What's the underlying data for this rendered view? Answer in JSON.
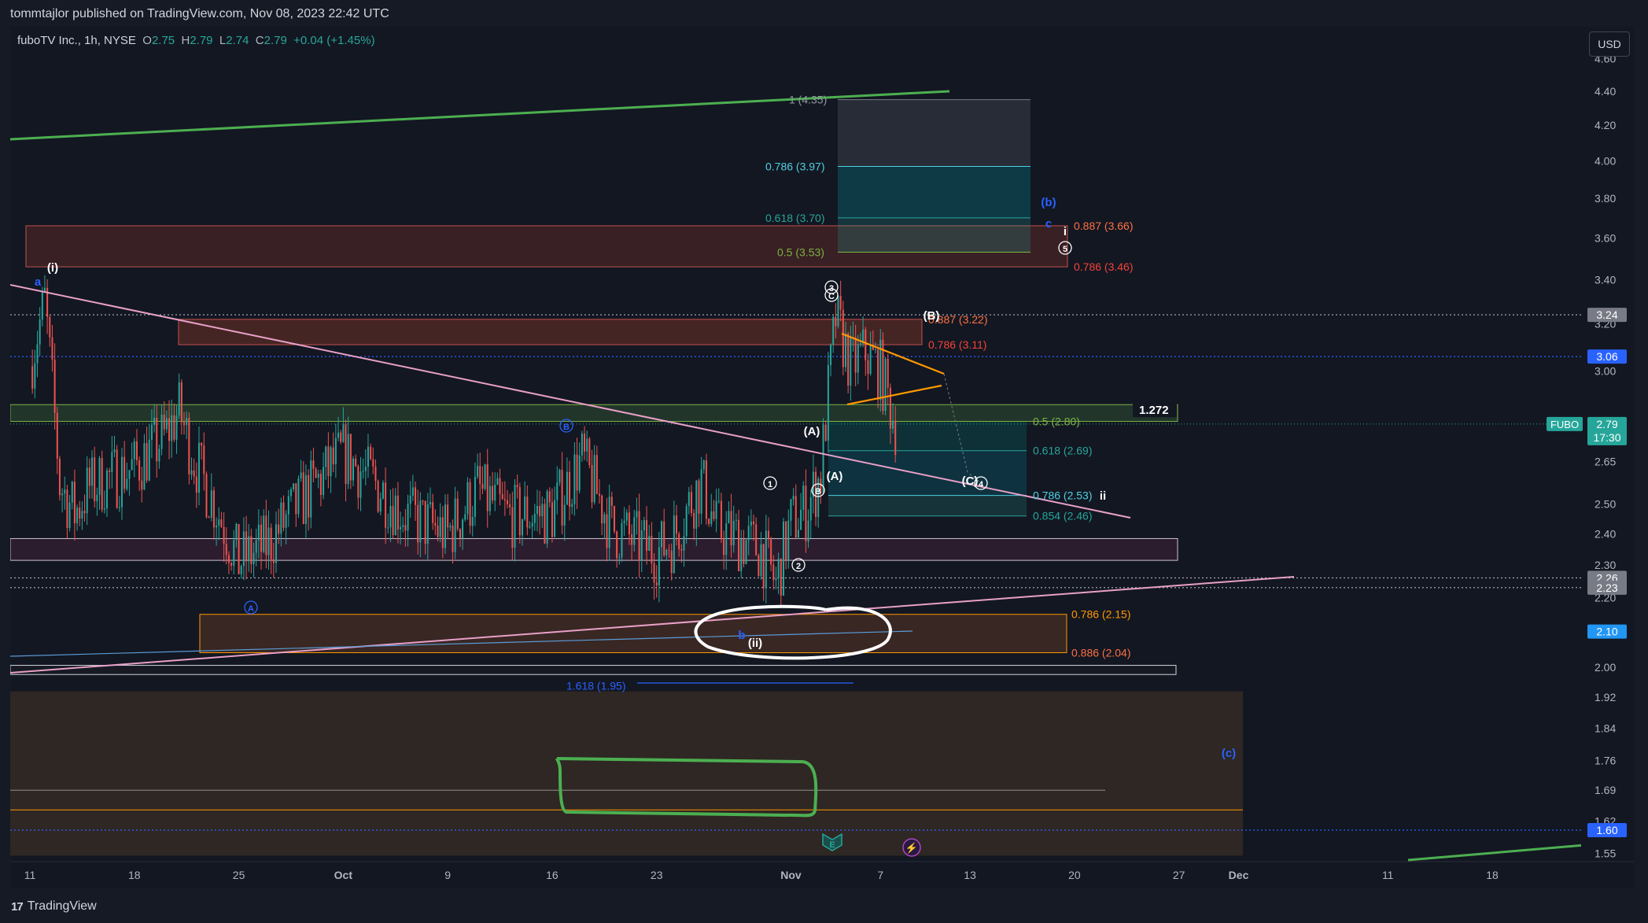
{
  "header": {
    "published_by": "tommtajlor published on TradingView.com, Nov 08, 2023 22:42 UTC"
  },
  "legend": {
    "symbol": "fuboTV Inc., 1h, NYSE",
    "o_label": "O",
    "o": "2.75",
    "h_label": "H",
    "h": "2.79",
    "l_label": "L",
    "l": "2.74",
    "c_label": "C",
    "c": "2.79",
    "change": "+0.04 (+1.45%)"
  },
  "currency_button": "USD",
  "footer": {
    "brand": "TradingView"
  },
  "colors": {
    "background": "#131722",
    "up": "#26a69a",
    "down": "#ef5350",
    "grid_text": "#b2b5be",
    "green_line": "#4caf50",
    "pink_line": "#e8a0c8",
    "orange": "#ff9800",
    "blue_label": "#2962ff",
    "fib_green": "#7cb342",
    "fib_teal": "#26a69a",
    "fib_cyan": "#4dd0e1",
    "fib_red": "#f44336",
    "fib_orange": "#ff9800"
  },
  "chart_data": {
    "type": "candlestick",
    "title": "fuboTV Inc., 1h, NYSE",
    "symbol": "FUBO",
    "x_ticks": [
      {
        "label": "11",
        "date": "2023-09-11"
      },
      {
        "label": "18",
        "date": "2023-09-18"
      },
      {
        "label": "25",
        "date": "2023-09-25"
      },
      {
        "label": "Oct",
        "date": "2023-10-02"
      },
      {
        "label": "9",
        "date": "2023-10-09"
      },
      {
        "label": "16",
        "date": "2023-10-16"
      },
      {
        "label": "23",
        "date": "2023-10-23"
      },
      {
        "label": "Nov",
        "date": "2023-11-01"
      },
      {
        "label": "7",
        "date": "2023-11-07"
      },
      {
        "label": "13",
        "date": "2023-11-13"
      },
      {
        "label": "20",
        "date": "2023-11-20"
      },
      {
        "label": "27",
        "date": "2023-11-27"
      },
      {
        "label": "Dec",
        "date": "2023-12-01"
      },
      {
        "label": "11",
        "date": "2023-12-11"
      },
      {
        "label": "18",
        "date": "2023-12-18"
      }
    ],
    "y_axis": {
      "scale": "log",
      "range": [
        1.52,
        4.62
      ],
      "tick_labels": [
        "4.60",
        "4.40",
        "4.20",
        "4.00",
        "3.80",
        "3.60",
        "3.40",
        "3.20",
        "3.00",
        "2.80",
        "2.65",
        "2.50",
        "2.40",
        "2.30",
        "2.20",
        "2.10",
        "2.00",
        "1.92",
        "1.84",
        "1.76",
        "1.69",
        "1.62",
        "1.55"
      ]
    },
    "price_markers": [
      {
        "value": "3.24",
        "style": "gray"
      },
      {
        "value": "3.06",
        "style": "blue"
      },
      {
        "value": "2.79",
        "style": "green",
        "countdown": "17:30",
        "symbol_tag": "FUBO"
      },
      {
        "value": "2.26",
        "style": "gray"
      },
      {
        "value": "2.23",
        "style": "gray"
      },
      {
        "value": "2.10",
        "style": "lightblue"
      },
      {
        "value": "1.60",
        "style": "blue"
      }
    ],
    "price_series": [
      {
        "date": "2023-09-11",
        "price": 3.02
      },
      {
        "date": "2023-09-12",
        "price": 3.3
      },
      {
        "date": "2023-09-13",
        "price": 2.57
      },
      {
        "date": "2023-09-14",
        "price": 2.47
      },
      {
        "date": "2023-09-15",
        "price": 2.56
      },
      {
        "date": "2023-09-18",
        "price": 2.63
      },
      {
        "date": "2023-09-20",
        "price": 2.74
      },
      {
        "date": "2023-09-21",
        "price": 2.84
      },
      {
        "date": "2023-09-22",
        "price": 2.66
      },
      {
        "date": "2023-09-25",
        "price": 2.31
      },
      {
        "date": "2023-09-27",
        "price": 2.37
      },
      {
        "date": "2023-09-29",
        "price": 2.5
      },
      {
        "date": "2023-10-02",
        "price": 2.68
      },
      {
        "date": "2023-10-04",
        "price": 2.58
      },
      {
        "date": "2023-10-06",
        "price": 2.47
      },
      {
        "date": "2023-10-09",
        "price": 2.4
      },
      {
        "date": "2023-10-11",
        "price": 2.55
      },
      {
        "date": "2023-10-13",
        "price": 2.46
      },
      {
        "date": "2023-10-16",
        "price": 2.47
      },
      {
        "date": "2023-10-18",
        "price": 2.66
      },
      {
        "date": "2023-10-20",
        "price": 2.42
      },
      {
        "date": "2023-10-23",
        "price": 2.34
      },
      {
        "date": "2023-10-24",
        "price": 2.38
      },
      {
        "date": "2023-10-26",
        "price": 2.58
      },
      {
        "date": "2023-10-27",
        "price": 2.42
      },
      {
        "date": "2023-10-30",
        "price": 2.35
      },
      {
        "date": "2023-10-31",
        "price": 2.24
      },
      {
        "date": "2023-11-01",
        "price": 2.44
      },
      {
        "date": "2023-11-02",
        "price": 2.48
      },
      {
        "date": "2023-11-03",
        "price": 2.6
      },
      {
        "date": "2023-11-04",
        "price": 3.23
      },
      {
        "date": "2023-11-05",
        "price": 3.02
      },
      {
        "date": "2023-11-06",
        "price": 3.08
      },
      {
        "date": "2023-11-07",
        "price": 3.0
      },
      {
        "date": "2023-11-08",
        "price": 2.79
      }
    ],
    "fib_labels": [
      {
        "text": "1 (4.35)",
        "value": 4.35,
        "color": "#9598a1"
      },
      {
        "text": "0.786 (3.97)",
        "value": 3.97,
        "color": "#4dd0e1"
      },
      {
        "text": "0.618 (3.70)",
        "value": 3.7,
        "color": "#26a69a"
      },
      {
        "text": "0.5 (3.53)",
        "value": 3.53,
        "color": "#7cb342"
      },
      {
        "text": "0.887 (3.66)",
        "value": 3.66,
        "color": "#ff7043"
      },
      {
        "text": "0.786 (3.46)",
        "value": 3.46,
        "color": "#f44336"
      },
      {
        "text": "0.887 (3.22)",
        "value": 3.22,
        "color": "#ff7043"
      },
      {
        "text": "0.786 (3.11)",
        "value": 3.11,
        "color": "#f44336"
      },
      {
        "text": "0.5 (2.80)",
        "value": 2.8,
        "color": "#7cb342"
      },
      {
        "text": "0.618 (2.69)",
        "value": 2.69,
        "color": "#26a69a"
      },
      {
        "text": "0.786 (2.53)",
        "value": 2.53,
        "color": "#4dd0e1"
      },
      {
        "text": "0.854 (2.46)",
        "value": 2.46,
        "color": "#26a69a"
      },
      {
        "text": "0.786 (2.15)",
        "value": 2.15,
        "color": "#ff9800"
      },
      {
        "text": "0.886 (2.04)",
        "value": 2.04,
        "color": "#ff7043"
      },
      {
        "text": "1.618 (1.95)",
        "value": 1.95,
        "color": "#2962ff"
      }
    ],
    "level_label": "1.272",
    "wave_labels": [
      "(i)",
      "a",
      "b",
      "(ii)",
      "B",
      "A",
      "(A)",
      "(B)",
      "(C)",
      "(b)",
      "c",
      "i",
      "ii",
      "(c)",
      "1",
      "2",
      "3",
      "4",
      "5",
      "C"
    ],
    "event_icons": [
      "E",
      "⚡"
    ]
  }
}
